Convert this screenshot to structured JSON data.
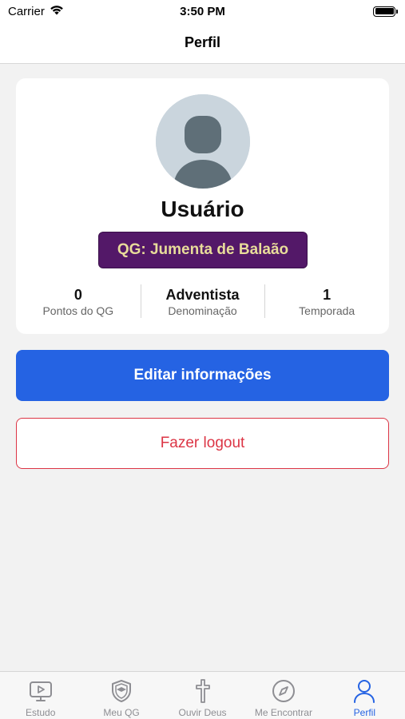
{
  "status_bar": {
    "carrier": "Carrier",
    "time": "3:50 PM"
  },
  "nav": {
    "title": "Perfil"
  },
  "profile": {
    "name": "Usuário",
    "qg_badge": "QG: Jumenta de Balaão",
    "stats": [
      {
        "value": "0",
        "label": "Pontos do QG"
      },
      {
        "value": "Adventista",
        "label": "Denominação"
      },
      {
        "value": "1",
        "label": "Temporada"
      }
    ]
  },
  "actions": {
    "edit_label": "Editar informações",
    "logout_label": "Fazer logout"
  },
  "tabs": [
    {
      "label": "Estudo",
      "icon": "play-screen-icon",
      "active": false
    },
    {
      "label": "Meu QG",
      "icon": "shield-icon",
      "active": false
    },
    {
      "label": "Ouvir Deus",
      "icon": "cross-icon",
      "active": false
    },
    {
      "label": "Me Encontrar",
      "icon": "compass-icon",
      "active": false
    },
    {
      "label": "Perfil",
      "icon": "person-icon",
      "active": true
    }
  ],
  "colors": {
    "primary": "#2563e3",
    "danger": "#dc3545",
    "badge_bg": "#531868",
    "badge_text": "#e8dc9a",
    "inactive_tab": "#8e8e93"
  }
}
